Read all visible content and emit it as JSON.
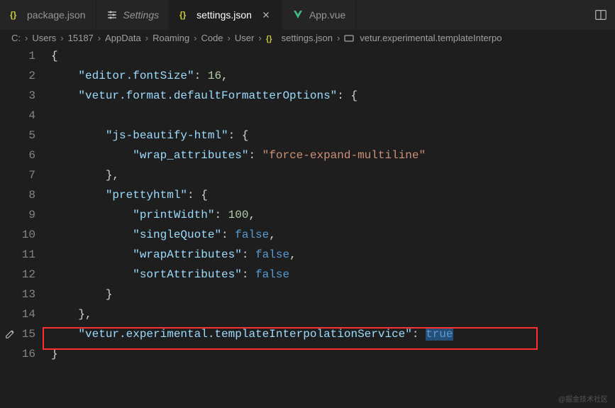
{
  "tabs": [
    {
      "label": "package.json",
      "iconColor": "#cbcb41",
      "active": false
    },
    {
      "label": "Settings",
      "iconType": "settings",
      "active": false,
      "italic": true
    },
    {
      "label": "settings.json",
      "iconColor": "#cbcb41",
      "active": true,
      "close": true
    },
    {
      "label": "App.vue",
      "iconType": "vue",
      "active": false
    }
  ],
  "breadcrumbs": {
    "segments": [
      "C:",
      "Users",
      "15187",
      "AppData",
      "Roaming",
      "Code",
      "User"
    ],
    "file": "settings.json",
    "symbol": "vetur.experimental.templateInterpo"
  },
  "code": {
    "lines": [
      {
        "num": "1",
        "tokens": [
          {
            "t": "{",
            "c": "punc"
          }
        ]
      },
      {
        "num": "2",
        "indent": 1,
        "tokens": [
          {
            "t": "\"editor.fontSize\"",
            "c": "key"
          },
          {
            "t": ": ",
            "c": "punc"
          },
          {
            "t": "16",
            "c": "num"
          },
          {
            "t": ",",
            "c": "punc"
          }
        ]
      },
      {
        "num": "3",
        "indent": 1,
        "tokens": [
          {
            "t": "\"vetur.format.defaultFormatterOptions\"",
            "c": "key"
          },
          {
            "t": ": {",
            "c": "punc"
          }
        ]
      },
      {
        "num": "4",
        "indent": 0,
        "tokens": []
      },
      {
        "num": "5",
        "indent": 2,
        "tokens": [
          {
            "t": "\"js-beautify-html\"",
            "c": "key"
          },
          {
            "t": ": {",
            "c": "punc"
          }
        ]
      },
      {
        "num": "6",
        "indent": 3,
        "tokens": [
          {
            "t": "\"wrap_attributes\"",
            "c": "key"
          },
          {
            "t": ": ",
            "c": "punc"
          },
          {
            "t": "\"force-expand-multiline\"",
            "c": "str"
          }
        ]
      },
      {
        "num": "7",
        "indent": 2,
        "tokens": [
          {
            "t": "},",
            "c": "punc"
          }
        ]
      },
      {
        "num": "8",
        "indent": 2,
        "tokens": [
          {
            "t": "\"prettyhtml\"",
            "c": "key"
          },
          {
            "t": ": {",
            "c": "punc"
          }
        ]
      },
      {
        "num": "9",
        "indent": 3,
        "tokens": [
          {
            "t": "\"printWidth\"",
            "c": "key"
          },
          {
            "t": ": ",
            "c": "punc"
          },
          {
            "t": "100",
            "c": "num"
          },
          {
            "t": ",",
            "c": "punc"
          }
        ]
      },
      {
        "num": "10",
        "indent": 3,
        "tokens": [
          {
            "t": "\"singleQuote\"",
            "c": "key"
          },
          {
            "t": ": ",
            "c": "punc"
          },
          {
            "t": "false",
            "c": "bool"
          },
          {
            "t": ",",
            "c": "punc"
          }
        ]
      },
      {
        "num": "11",
        "indent": 3,
        "tokens": [
          {
            "t": "\"wrapAttributes\"",
            "c": "key"
          },
          {
            "t": ": ",
            "c": "punc"
          },
          {
            "t": "false",
            "c": "bool"
          },
          {
            "t": ",",
            "c": "punc"
          }
        ]
      },
      {
        "num": "12",
        "indent": 3,
        "tokens": [
          {
            "t": "\"sortAttributes\"",
            "c": "key"
          },
          {
            "t": ": ",
            "c": "punc"
          },
          {
            "t": "false",
            "c": "bool"
          }
        ]
      },
      {
        "num": "13",
        "indent": 2,
        "tokens": [
          {
            "t": "}",
            "c": "punc"
          }
        ]
      },
      {
        "num": "14",
        "indent": 1,
        "tokens": [
          {
            "t": "},",
            "c": "punc"
          }
        ]
      },
      {
        "num": "15",
        "indent": 1,
        "modified": true,
        "tokens": [
          {
            "t": "\"vetur.experimental.templateInterpolationService\"",
            "c": "key"
          },
          {
            "t": ": ",
            "c": "punc"
          },
          {
            "t": "true",
            "c": "bool",
            "sel": true
          }
        ]
      },
      {
        "num": "16",
        "tokens": [
          {
            "t": "}",
            "c": "punc"
          }
        ]
      }
    ]
  },
  "watermark": "@掘金技术社区"
}
